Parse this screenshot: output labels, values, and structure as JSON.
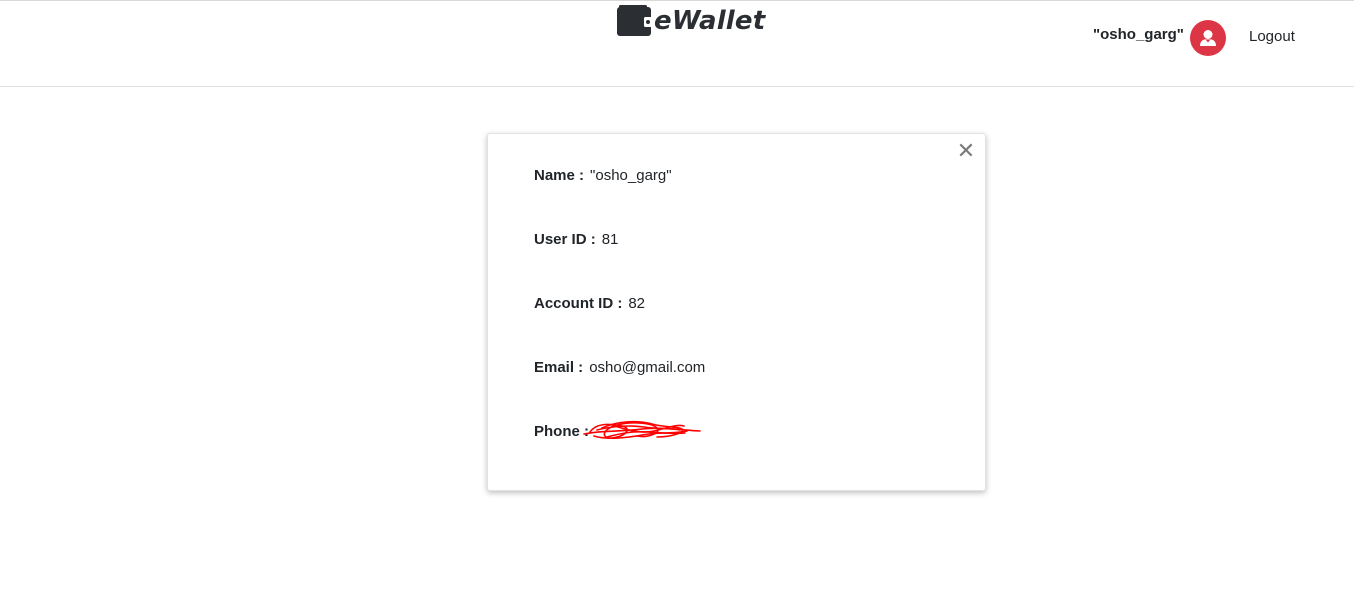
{
  "brand": {
    "name": "eWallet",
    "icon": "wallet-icon"
  },
  "nav": {
    "username": "\"osho_garg\"",
    "avatar_icon": "user-icon",
    "avatar_color": "#dc3545",
    "logout_label": "Logout"
  },
  "profile": {
    "close_icon": "close-icon",
    "close_glyph": "✕",
    "fields": [
      {
        "label": "Name :",
        "value": "\"osho_garg\""
      },
      {
        "label": "User ID :",
        "value": "81"
      },
      {
        "label": "Account ID :",
        "value": "82"
      },
      {
        "label": "Email :",
        "value": "osho@gmail.com"
      },
      {
        "label": "Phone :",
        "value": ""
      }
    ],
    "redaction_color": "#ff0000"
  }
}
